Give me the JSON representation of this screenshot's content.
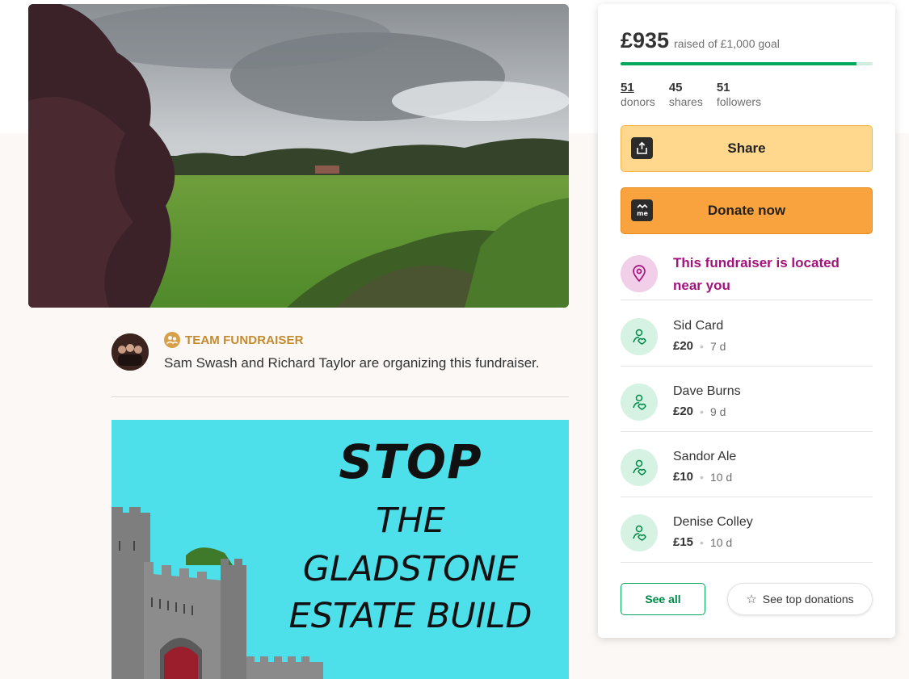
{
  "organizer": {
    "type_label": "TEAM FUNDRAISER",
    "text": "Sam Swash and Richard Taylor are organizing this fundraiser."
  },
  "poster": {
    "line1": "STOP",
    "line2": "THE",
    "line3": "GLADSTONE",
    "line4": "ESTATE BUILD"
  },
  "summary": {
    "raised": "£935",
    "goal_text": "raised of £1,000 goal",
    "progress_fraction": 0.935,
    "colors": {
      "accent": "#02a95c",
      "progress_track": "#cfeee0"
    },
    "stats": [
      {
        "value": "51",
        "label": "donors"
      },
      {
        "value": "45",
        "label": "shares"
      },
      {
        "value": "51",
        "label": "followers"
      }
    ]
  },
  "actions": {
    "share_label": "Share",
    "share_icon": "share-upload-icon",
    "donate_label": "Donate now",
    "donate_icon": "gofundme-logo-icon"
  },
  "nearby": {
    "text": "This fundraiser is located near you",
    "icon": "location-pin-icon",
    "color": "#a3137d"
  },
  "donations": [
    {
      "name": "Sid Card",
      "amount": "£20",
      "time": "7 d"
    },
    {
      "name": "Dave Burns",
      "amount": "£20",
      "time": "9 d"
    },
    {
      "name": "Sandor Ale",
      "amount": "£10",
      "time": "10 d"
    },
    {
      "name": "Denise Colley",
      "amount": "£15",
      "time": "10 d"
    }
  ],
  "footer": {
    "see_all": "See all",
    "see_top": "See top donations"
  }
}
